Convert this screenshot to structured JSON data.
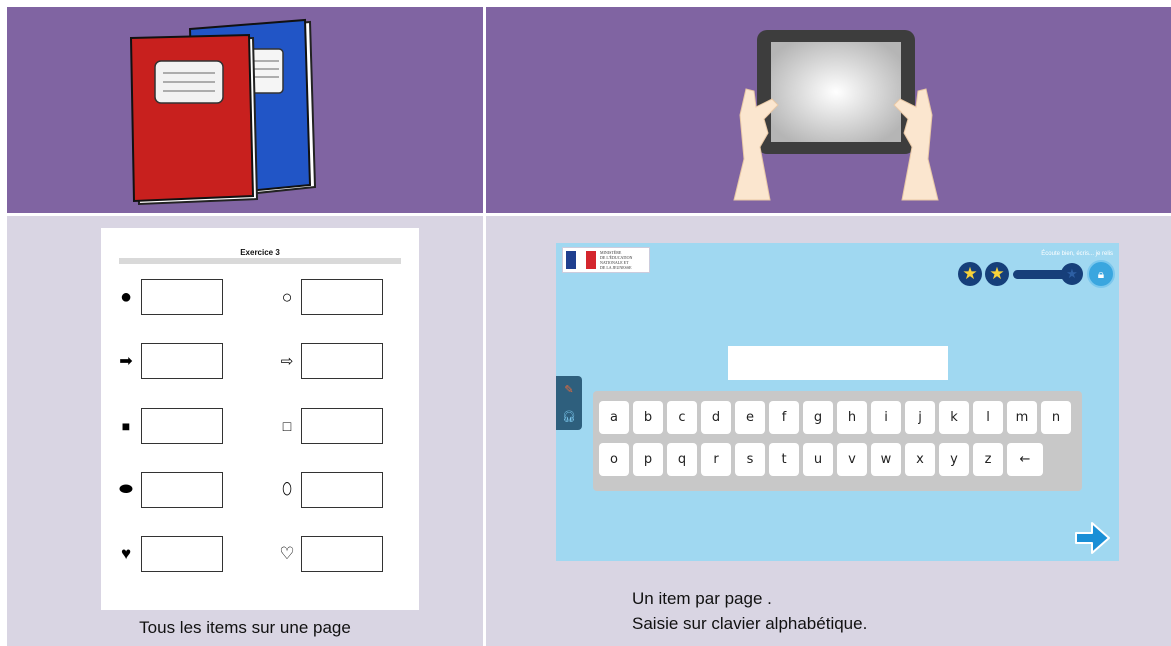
{
  "worksheet": {
    "title": "Exercice 3",
    "rows": [
      {
        "left": "●",
        "right": "○"
      },
      {
        "left": "➡",
        "right": "⇨"
      },
      {
        "left": "■",
        "right": "□"
      },
      {
        "left": "⬬",
        "right": "⬯"
      },
      {
        "left": "♥",
        "right": "♡"
      }
    ]
  },
  "captions": {
    "left": "Tous les items sur une page",
    "right_line1": "Un item par page .",
    "right_line2": "Saisie sur clavier alphabétique."
  },
  "app": {
    "logo_text": [
      "MINISTÈRE",
      "DE L'ÉDUCATION",
      "NATIONALE ET",
      "DE LA JEUNESSE"
    ],
    "hint": "Écoute bien, écris... je relis",
    "stars": "★",
    "answer_value": "",
    "keyboard_row1": [
      "a",
      "b",
      "c",
      "d",
      "e",
      "f",
      "g",
      "h",
      "i",
      "j",
      "k",
      "l",
      "m",
      "n"
    ],
    "keyboard_row2": [
      "o",
      "p",
      "q",
      "r",
      "s",
      "t",
      "u",
      "v",
      "w",
      "x",
      "y",
      "z",
      "←"
    ],
    "colors": {
      "background": "#a0d8f1",
      "accent": "#1a8fd6",
      "star": "#f7d23a",
      "dark": "#163f7a"
    }
  },
  "icons": {
    "notebooks": "notebooks-icon",
    "tablet": "tablet-hands-icon",
    "pencil": "pencil-icon",
    "headphones": "headphones-icon",
    "lock": "lock-icon",
    "next": "arrow-right-icon"
  }
}
